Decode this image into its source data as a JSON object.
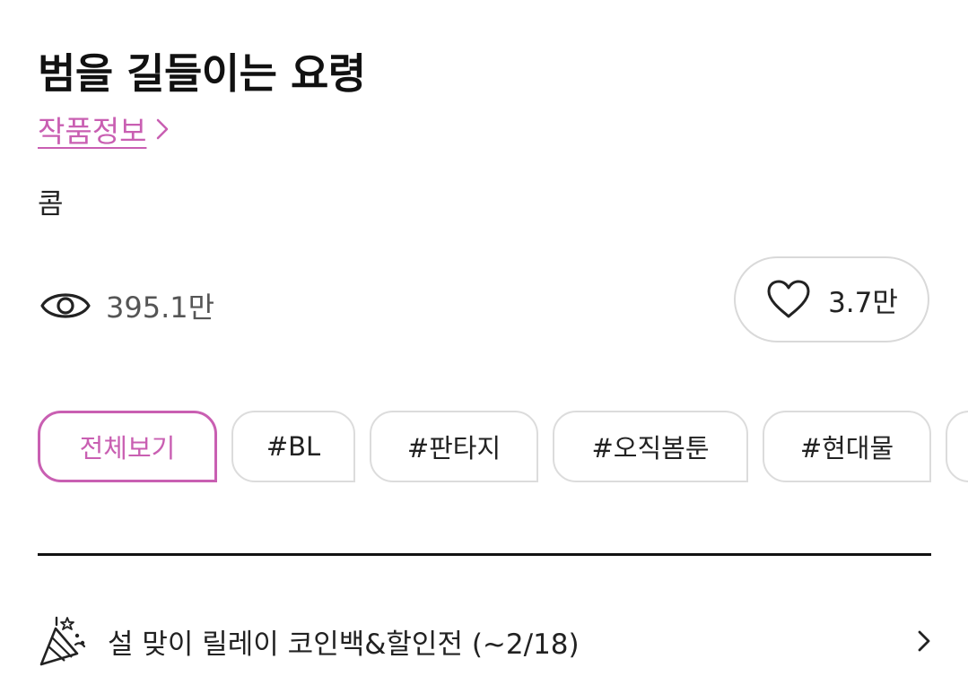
{
  "header": {
    "title": "범을 길들이는 요령",
    "info_link_label": "작품정보",
    "author": "콤"
  },
  "stats": {
    "views": "395.1만",
    "likes": "3.7만"
  },
  "tags": [
    {
      "label": "전체보기",
      "active": true
    },
    {
      "label": "#BL",
      "active": false
    },
    {
      "label": "#판타지",
      "active": false
    },
    {
      "label": "#오직봄툰",
      "active": false
    },
    {
      "label": "#현대물",
      "active": false
    }
  ],
  "event": {
    "label": "설 맞이 릴레이 코인백&할인전 (~2/18)"
  },
  "icons": {
    "info_chevron": "chevron-right-icon",
    "views": "eye-icon",
    "likes": "heart-outline-icon",
    "event": "party-popper-icon",
    "event_chevron": "chevron-right-icon"
  },
  "colors": {
    "accent": "#c95fb2",
    "text": "#222222",
    "muted": "#555555",
    "border": "#dcdcdc"
  }
}
